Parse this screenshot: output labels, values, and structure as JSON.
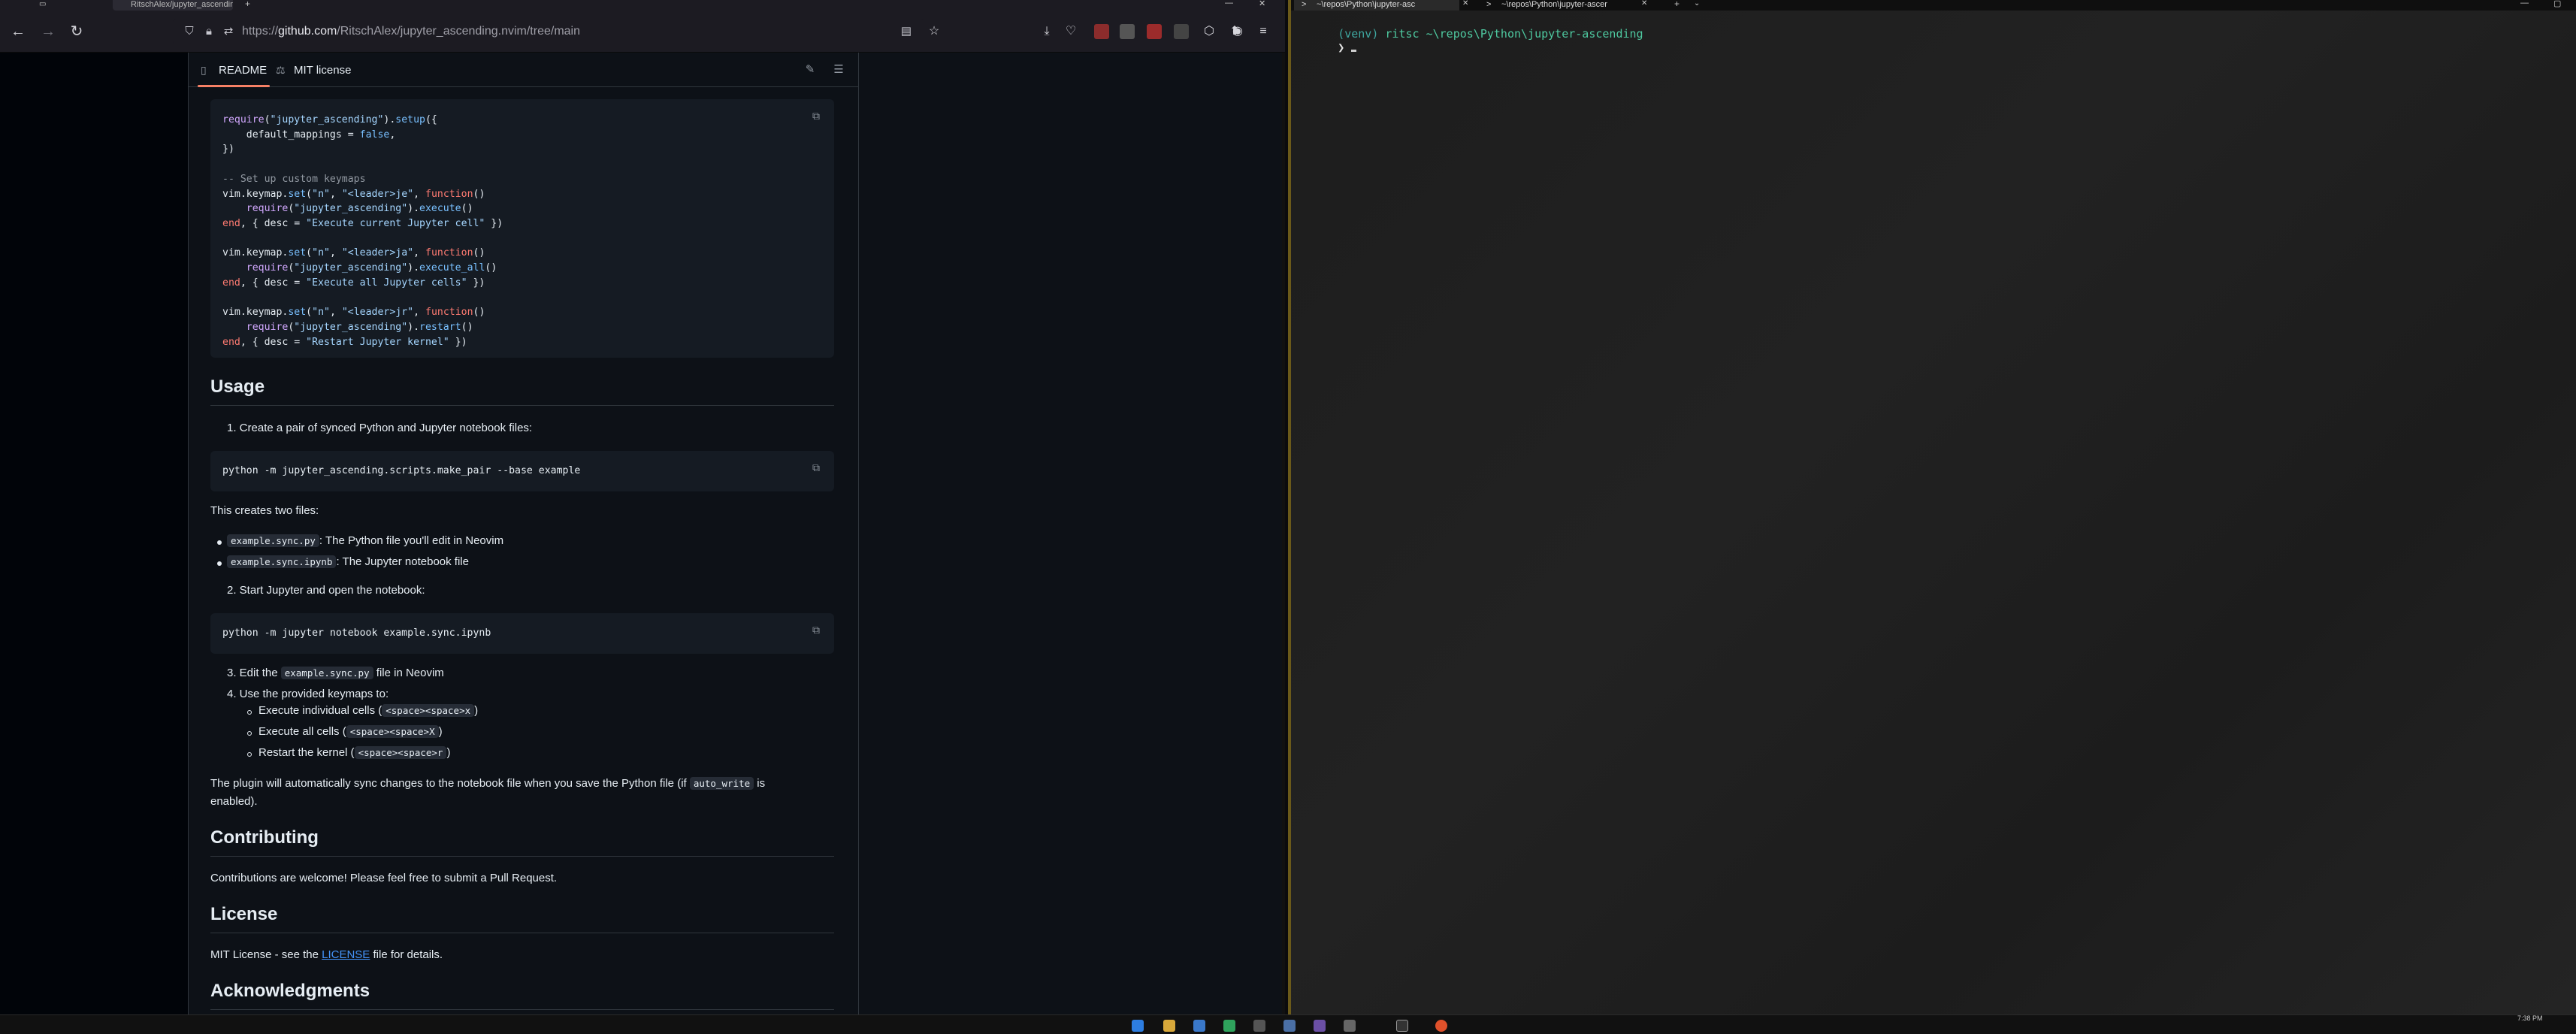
{
  "browser": {
    "tabs": [
      {
        "label": "RitschAlex/jupyter_ascending.nvim"
      }
    ],
    "url": {
      "prefix": "https://",
      "host": "github.com",
      "path": "/RitschAlex/jupyter_ascending.nvim/tree/main"
    }
  },
  "readme": {
    "tabs": {
      "readme": "README",
      "license": "MIT license"
    },
    "code1": [
      [
        [
          "f",
          "require"
        ],
        [
          "n",
          "("
        ],
        [
          "s",
          "\"jupyter_ascending\""
        ],
        [
          "n",
          ")."
        ],
        [
          "p",
          "setup"
        ],
        [
          "n",
          "({"
        ]
      ],
      [
        [
          "n",
          "    default_mappings = "
        ],
        [
          "p",
          "false"
        ],
        [
          "n",
          ","
        ]
      ],
      [
        [
          "n",
          "})"
        ]
      ],
      [],
      [
        [
          "c",
          "-- Set up custom keymaps"
        ]
      ],
      [
        [
          "n",
          "vim.keymap."
        ],
        [
          "p",
          "set"
        ],
        [
          "n",
          "("
        ],
        [
          "s",
          "\"n\""
        ],
        [
          "n",
          ", "
        ],
        [
          "s",
          "\"<leader>je\""
        ],
        [
          "n",
          ", "
        ],
        [
          "k",
          "function"
        ],
        [
          "n",
          "()"
        ]
      ],
      [
        [
          "n",
          "    "
        ],
        [
          "f",
          "require"
        ],
        [
          "n",
          "("
        ],
        [
          "s",
          "\"jupyter_ascending\""
        ],
        [
          "n",
          ")."
        ],
        [
          "p",
          "execute"
        ],
        [
          "n",
          "()"
        ]
      ],
      [
        [
          "k",
          "end"
        ],
        [
          "n",
          ", { desc = "
        ],
        [
          "s",
          "\"Execute current Jupyter cell\""
        ],
        [
          "n",
          " })"
        ]
      ],
      [],
      [
        [
          "n",
          "vim.keymap."
        ],
        [
          "p",
          "set"
        ],
        [
          "n",
          "("
        ],
        [
          "s",
          "\"n\""
        ],
        [
          "n",
          ", "
        ],
        [
          "s",
          "\"<leader>ja\""
        ],
        [
          "n",
          ", "
        ],
        [
          "k",
          "function"
        ],
        [
          "n",
          "()"
        ]
      ],
      [
        [
          "n",
          "    "
        ],
        [
          "f",
          "require"
        ],
        [
          "n",
          "("
        ],
        [
          "s",
          "\"jupyter_ascending\""
        ],
        [
          "n",
          ")."
        ],
        [
          "p",
          "execute_all"
        ],
        [
          "n",
          "()"
        ]
      ],
      [
        [
          "k",
          "end"
        ],
        [
          "n",
          ", { desc = "
        ],
        [
          "s",
          "\"Execute all Jupyter cells\""
        ],
        [
          "n",
          " })"
        ]
      ],
      [],
      [
        [
          "n",
          "vim.keymap."
        ],
        [
          "p",
          "set"
        ],
        [
          "n",
          "("
        ],
        [
          "s",
          "\"n\""
        ],
        [
          "n",
          ", "
        ],
        [
          "s",
          "\"<leader>jr\""
        ],
        [
          "n",
          ", "
        ],
        [
          "k",
          "function"
        ],
        [
          "n",
          "()"
        ]
      ],
      [
        [
          "n",
          "    "
        ],
        [
          "f",
          "require"
        ],
        [
          "n",
          "("
        ],
        [
          "s",
          "\"jupyter_ascending\""
        ],
        [
          "n",
          ")."
        ],
        [
          "p",
          "restart"
        ],
        [
          "n",
          "()"
        ]
      ],
      [
        [
          "k",
          "end"
        ],
        [
          "n",
          ", { desc = "
        ],
        [
          "s",
          "\"Restart Jupyter kernel\""
        ],
        [
          "n",
          " })"
        ]
      ]
    ],
    "usage_heading": "Usage",
    "step1": "1. Create a pair of synced Python and Jupyter notebook files:",
    "code2": "python -m jupyter_ascending.scripts.make_pair --base example",
    "creates": "This creates two files:",
    "file1_code": "example.sync.py",
    "file1_desc": ": The Python file you'll edit in Neovim",
    "file2_code": "example.sync.ipynb",
    "file2_desc": ": The Jupyter notebook file",
    "step2": "2. Start Jupyter and open the notebook:",
    "code3": "python -m jupyter notebook example.sync.ipynb",
    "step3_pre": "3. Edit the ",
    "step3_code": "example.sync.py",
    "step3_post": " file in Neovim",
    "step4": "4. Use the provided keymaps to:",
    "km1_pre": "Execute individual cells (",
    "km1_code": "<space><space>x",
    "km1_post": ")",
    "km2_pre": "Execute all cells (",
    "km2_code": "<space><space>X",
    "km2_post": ")",
    "km3_pre": "Restart the kernel (",
    "km3_code": "<space><space>r",
    "km3_post": ")",
    "sync_pre": "The plugin will automatically sync changes to the notebook file when you save the Python file (if ",
    "sync_code": "auto_write",
    "sync_post": " is",
    "sync_line2": "enabled).",
    "contrib_heading": "Contributing",
    "contrib_text": "Contributions are welcome! Please feel free to submit a Pull Request.",
    "license_heading": "License",
    "license_pre": "MIT License - see the ",
    "license_link": "LICENSE",
    "license_post": " file for details.",
    "ack_heading": "Acknowledgments"
  },
  "terminal": {
    "tabs": [
      {
        "label": "~\\repos\\Python\\jupyter-asc"
      },
      {
        "label": "~\\repos\\Python\\jupyter-ascer"
      }
    ],
    "prompt_venv": "(venv)",
    "prompt_user": "ritsc",
    "prompt_path": "~\\repos\\Python\\jupyter-ascending",
    "prompt_symbol": "❯"
  },
  "taskbar": {
    "clock": "7:38 PM"
  },
  "colors": {
    "accent_underline": "#f78166",
    "terminal_green": "#4ec9a0",
    "link": "#4493f8"
  }
}
